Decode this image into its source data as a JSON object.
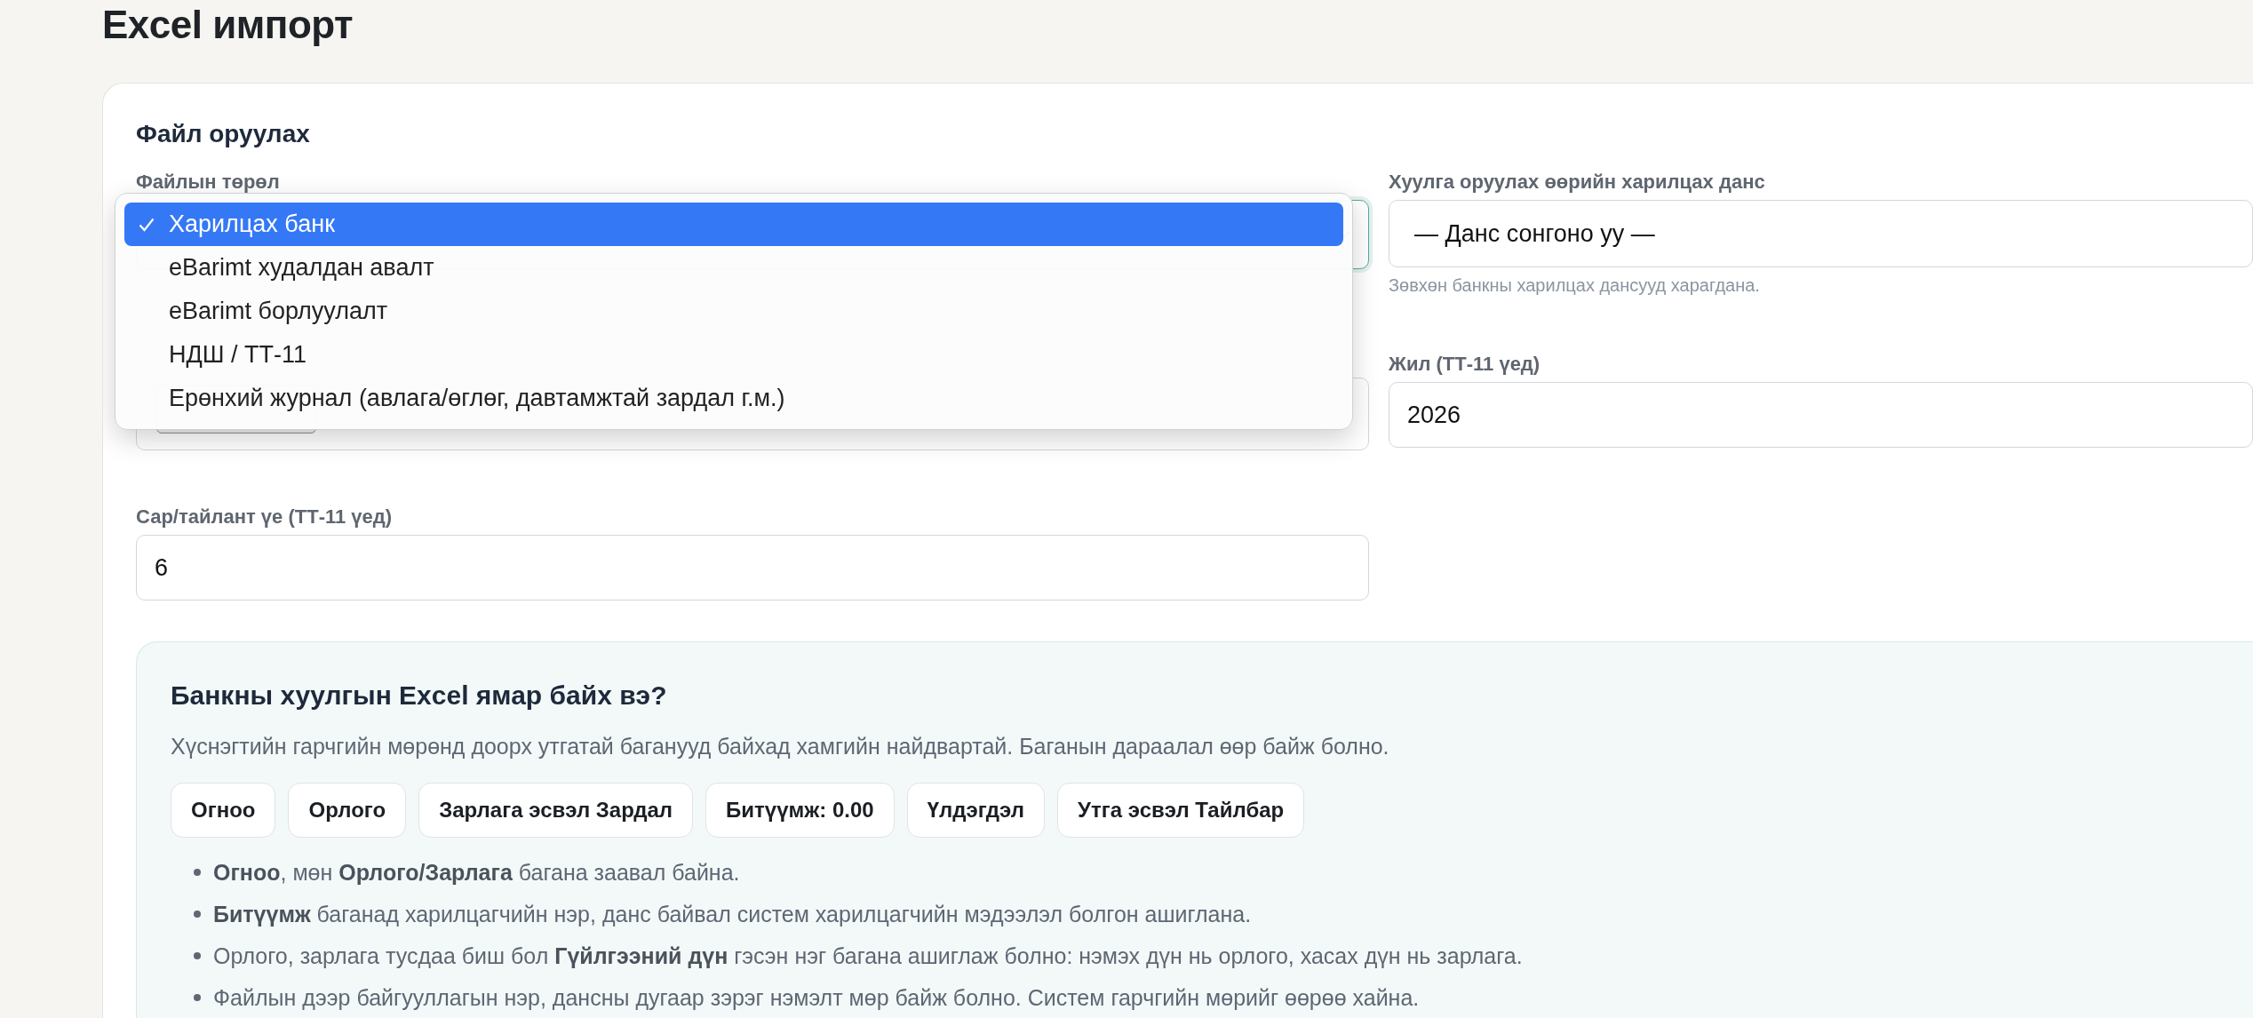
{
  "page_title": "Excel импорт",
  "upload_card": {
    "title": "Файл оруулах",
    "file_type": {
      "label": "Файлын төрөл",
      "dropdown_open": true,
      "focused": true,
      "options": [
        {
          "label": "Харилцах банк",
          "selected": true
        },
        {
          "label": "eBarimt худалдан авалт",
          "selected": false
        },
        {
          "label": "eBarimt борлуулалт",
          "selected": false
        },
        {
          "label": "НДШ / ТТ-11",
          "selected": false
        },
        {
          "label": "Ерөнхий журнал (авлага/өглөг, давтамжтай зардал г.м.)",
          "selected": false
        }
      ]
    },
    "bank_account": {
      "label": "Хуулга оруулах өөрийн харилцах данс",
      "value": "— Данс сонгоно уу —",
      "hint": "Зөвхөн банкны харилцах дансууд харагдана."
    },
    "year": {
      "label": "Жил (ТТ-11 үед)",
      "value": "2026"
    },
    "period": {
      "label": "Сар/тайлант үе (ТТ-11 үед)",
      "value": "6"
    }
  },
  "help_box": {
    "title": "Банкны хуулгын Excel ямар байх вэ?",
    "intro": "Хүснэгтийн гарчгийн мөрөнд доорх утгатай баганууд байхад хамгийн найдвартай. Баганын дараалал өөр байж болно.",
    "columns": [
      "Огноо",
      "Орлого",
      "Зарлага эсвэл Зардал",
      "Битүүмж: 0.00",
      "Үлдэгдэл",
      "Утга эсвэл Тайлбар"
    ],
    "bullets": [
      "**Огноо**, мөн **Орлого/Зарлага** багана заавал байна.",
      "**Битүүмж** баганад харилцагчийн нэр, данс байвал систем харилцагчийн мэдээлэл болгон ашиглана.",
      "Орлого, зарлага тусдаа биш бол **Гүйлгээний дүн** гэсэн нэг багана ашиглаж болно: нэмэх дүн нь орлого, хасах дүн нь зарлага.",
      "Файлын дээр байгууллагын нэр, дансны дугаар зэрэг нэмэлт мөр байж болно. Систем гарчгийн мөрийг өөрөө хайна."
    ]
  }
}
